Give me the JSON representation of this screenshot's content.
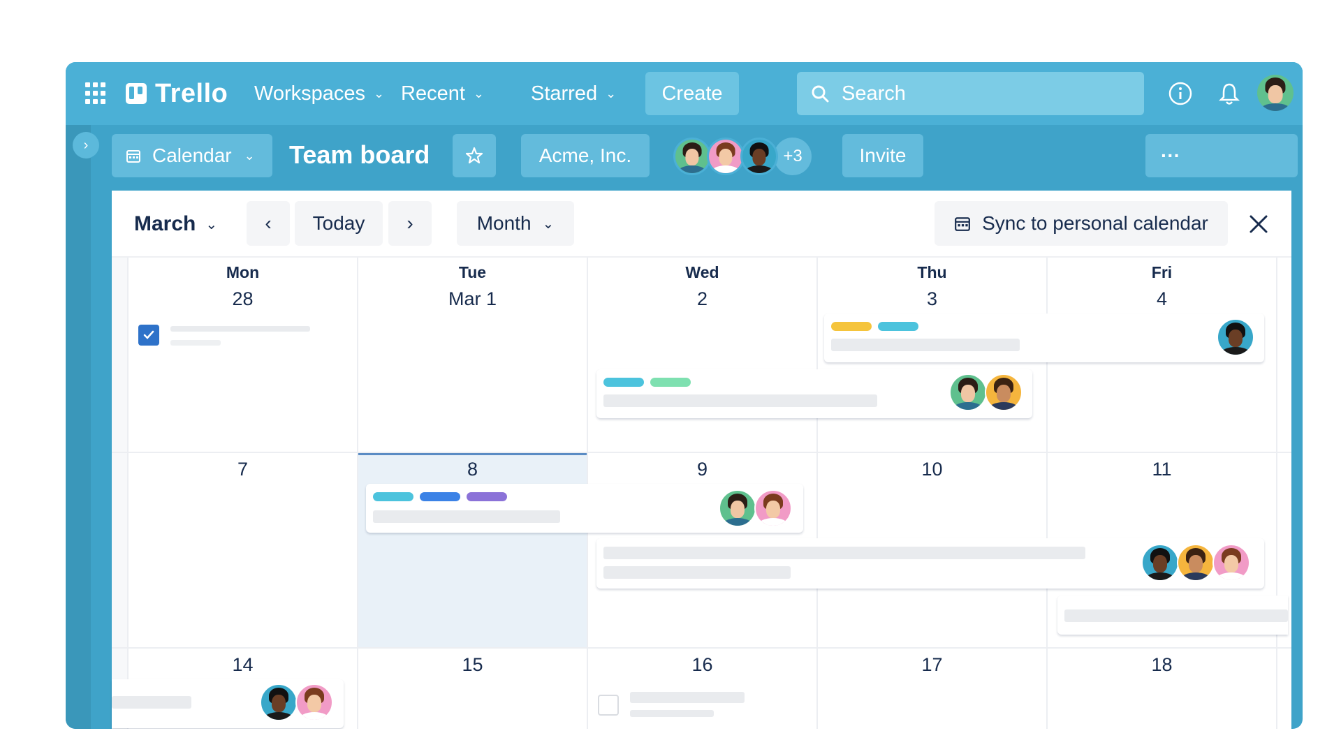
{
  "topbar": {
    "logo": "Trello",
    "menus": [
      {
        "label": "Workspaces"
      },
      {
        "label": "Recent"
      },
      {
        "label": "Starred"
      }
    ],
    "create_label": "Create",
    "search_placeholder": "Search"
  },
  "boardbar": {
    "view_label": "Calendar",
    "title": "Team board",
    "workspace_label": "Acme, Inc.",
    "extra_members": "+3",
    "invite_label": "Invite",
    "more_label": "···"
  },
  "calendar": {
    "month_label": "March",
    "today_label": "Today",
    "view_mode": "Month",
    "sync_label": "Sync to personal calendar",
    "days": [
      {
        "name": "Mon",
        "date": "28"
      },
      {
        "name": "Tue",
        "date": "Mar 1"
      },
      {
        "name": "Wed",
        "date": "2"
      },
      {
        "name": "Thu",
        "date": "3"
      },
      {
        "name": "Fri",
        "date": "4"
      }
    ],
    "week2": [
      "7",
      "8",
      "9",
      "10",
      "11"
    ],
    "week3": [
      "14",
      "15",
      "16",
      "17",
      "18"
    ]
  },
  "colors": {
    "brand": "#4bb0d6",
    "label_yellow": "#f5c43c",
    "label_cyan": "#4cc3dd",
    "label_green": "#7ee0b0",
    "label_blue": "#3b82e6",
    "label_purple": "#8b72d8",
    "avatar_green": "#5fc08e",
    "avatar_pink": "#f19bc6",
    "avatar_teal": "#38a7c9",
    "avatar_orange": "#f5b53d"
  }
}
